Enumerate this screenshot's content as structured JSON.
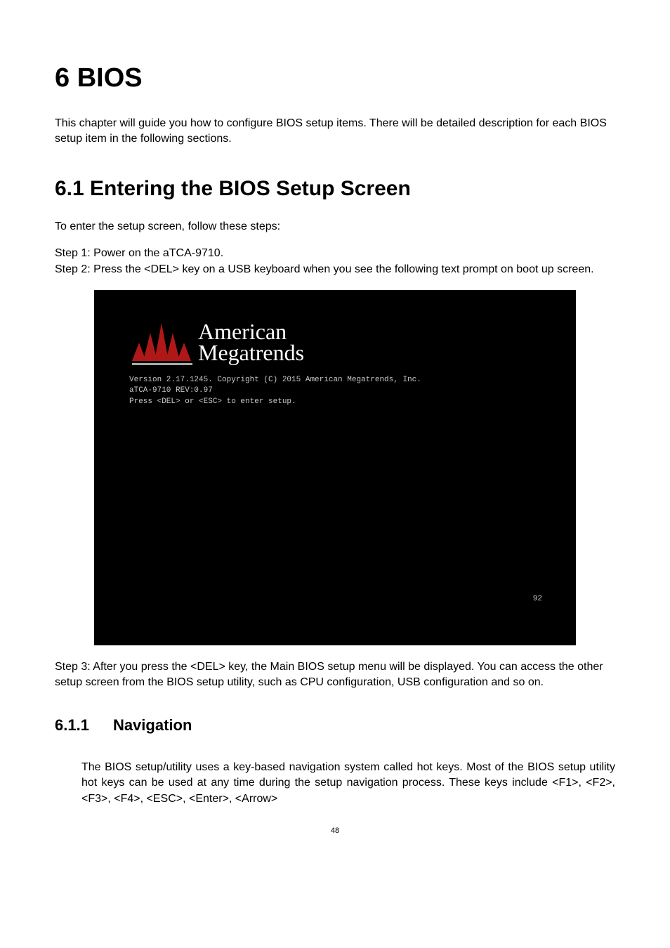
{
  "chapterTitle": "6 BIOS",
  "introText": "This chapter will guide you how to configure BIOS setup items. There will be detailed description for each BIOS setup item in the following sections.",
  "sectionTitle": "6.1 Entering the BIOS Setup Screen",
  "setupIntro": "To enter the setup screen, follow these steps:",
  "step1": "Step 1: Power on the aTCA-9710.",
  "step2": "Step 2: Press the <DEL> key on a USB keyboard when you see the following text prompt on boot up screen.",
  "biosImage": {
    "logoLine1": "American",
    "logoLine2": "Megatrends",
    "terminalLine1": "Version 2.17.1245. Copyright (C) 2015 American Megatrends, Inc.",
    "terminalLine2": "aTCA-9710 REV:0.97",
    "terminalLine3": "Press <DEL> or <ESC> to enter setup.",
    "cornerNumber": "92"
  },
  "step3": "Step 3: After you press the <DEL> key, the Main BIOS setup menu will be displayed. You can access the other setup screen from the BIOS setup utility, such as CPU configuration, USB configuration and so on.",
  "subsection": {
    "number": "6.1.1",
    "title": "Navigation",
    "body": "The BIOS setup/utility uses a key-based navigation system called hot keys. Most of the BIOS setup utility hot keys can be used at any time during the setup navigation process. These keys include <F1>, <F2>, <F3>, <F4>, <ESC>, <Enter>, <Arrow>"
  },
  "pageNumber": "48"
}
